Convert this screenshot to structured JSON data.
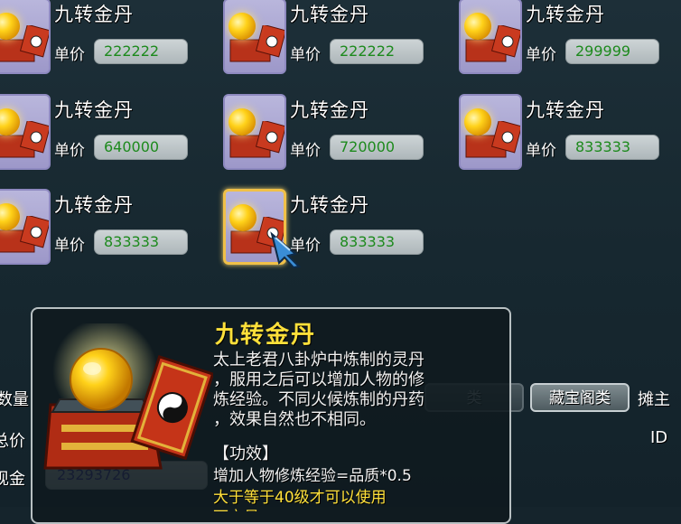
{
  "listing": {
    "price_label": "单价",
    "items": [
      {
        "name": "九转金丹",
        "price": "222222"
      },
      {
        "name": "九转金丹",
        "price": "222222"
      },
      {
        "name": "九转金丹",
        "price": "299999"
      },
      {
        "name": "九转金丹",
        "price": "640000"
      },
      {
        "name": "九转金丹",
        "price": "720000"
      },
      {
        "name": "九转金丹",
        "price": "833333"
      },
      {
        "name": "九转金丹",
        "price": "833333"
      },
      {
        "name": "九转金丹",
        "price": "833333"
      }
    ]
  },
  "bottom": {
    "qty_label_fragment": "数量",
    "price_label_fragment": "总价",
    "money_label_fragment": "现金",
    "money_value": "23293726",
    "buttons": {
      "category_button": "藏宝阁类",
      "faded_button": "类",
      "stall_owner_fragment": "摊主",
      "id_fragment": "ID"
    }
  },
  "tooltip": {
    "title": "九转金丹",
    "description": "太上老君八卦炉中炼制的灵丹\n，服用之后可以增加人物的修\n炼经验。不同火候炼制的丹药\n，效果自然也不相同。",
    "effect_label": "【功效】",
    "effect": "增加人物修炼经验=品质*0.5",
    "requirement": "大于等于40级才可以使用",
    "requirement_more": "可交易"
  },
  "colors": {
    "title_yellow": "#ffe03a",
    "price_green": "#1d8a1d",
    "money_blue": "#3a2fa0",
    "selected_border": "#f0c048"
  }
}
